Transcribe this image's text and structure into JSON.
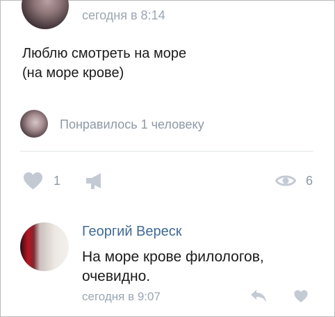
{
  "post": {
    "time": "сегодня в 8:14",
    "text_line1": "Люблю смотреть на море",
    "text_line2": "(на море крове)",
    "liked_by": "Понравилось 1 человеку",
    "likes": "1",
    "views": "6"
  },
  "comment": {
    "author": "Георгий Вереск",
    "text_line1": "На море крове филологов,",
    "text_line2": "очевидно.",
    "time": "сегодня в 9:07"
  },
  "icons": {
    "like": "heart-icon",
    "share": "megaphone-icon",
    "views": "eye-icon",
    "reply": "reply-arrow-icon",
    "comment_like": "heart-icon"
  },
  "colors": {
    "icon_gray": "#c4cad3",
    "meta_text": "#8e99a5",
    "author_link": "#3f6a96"
  }
}
